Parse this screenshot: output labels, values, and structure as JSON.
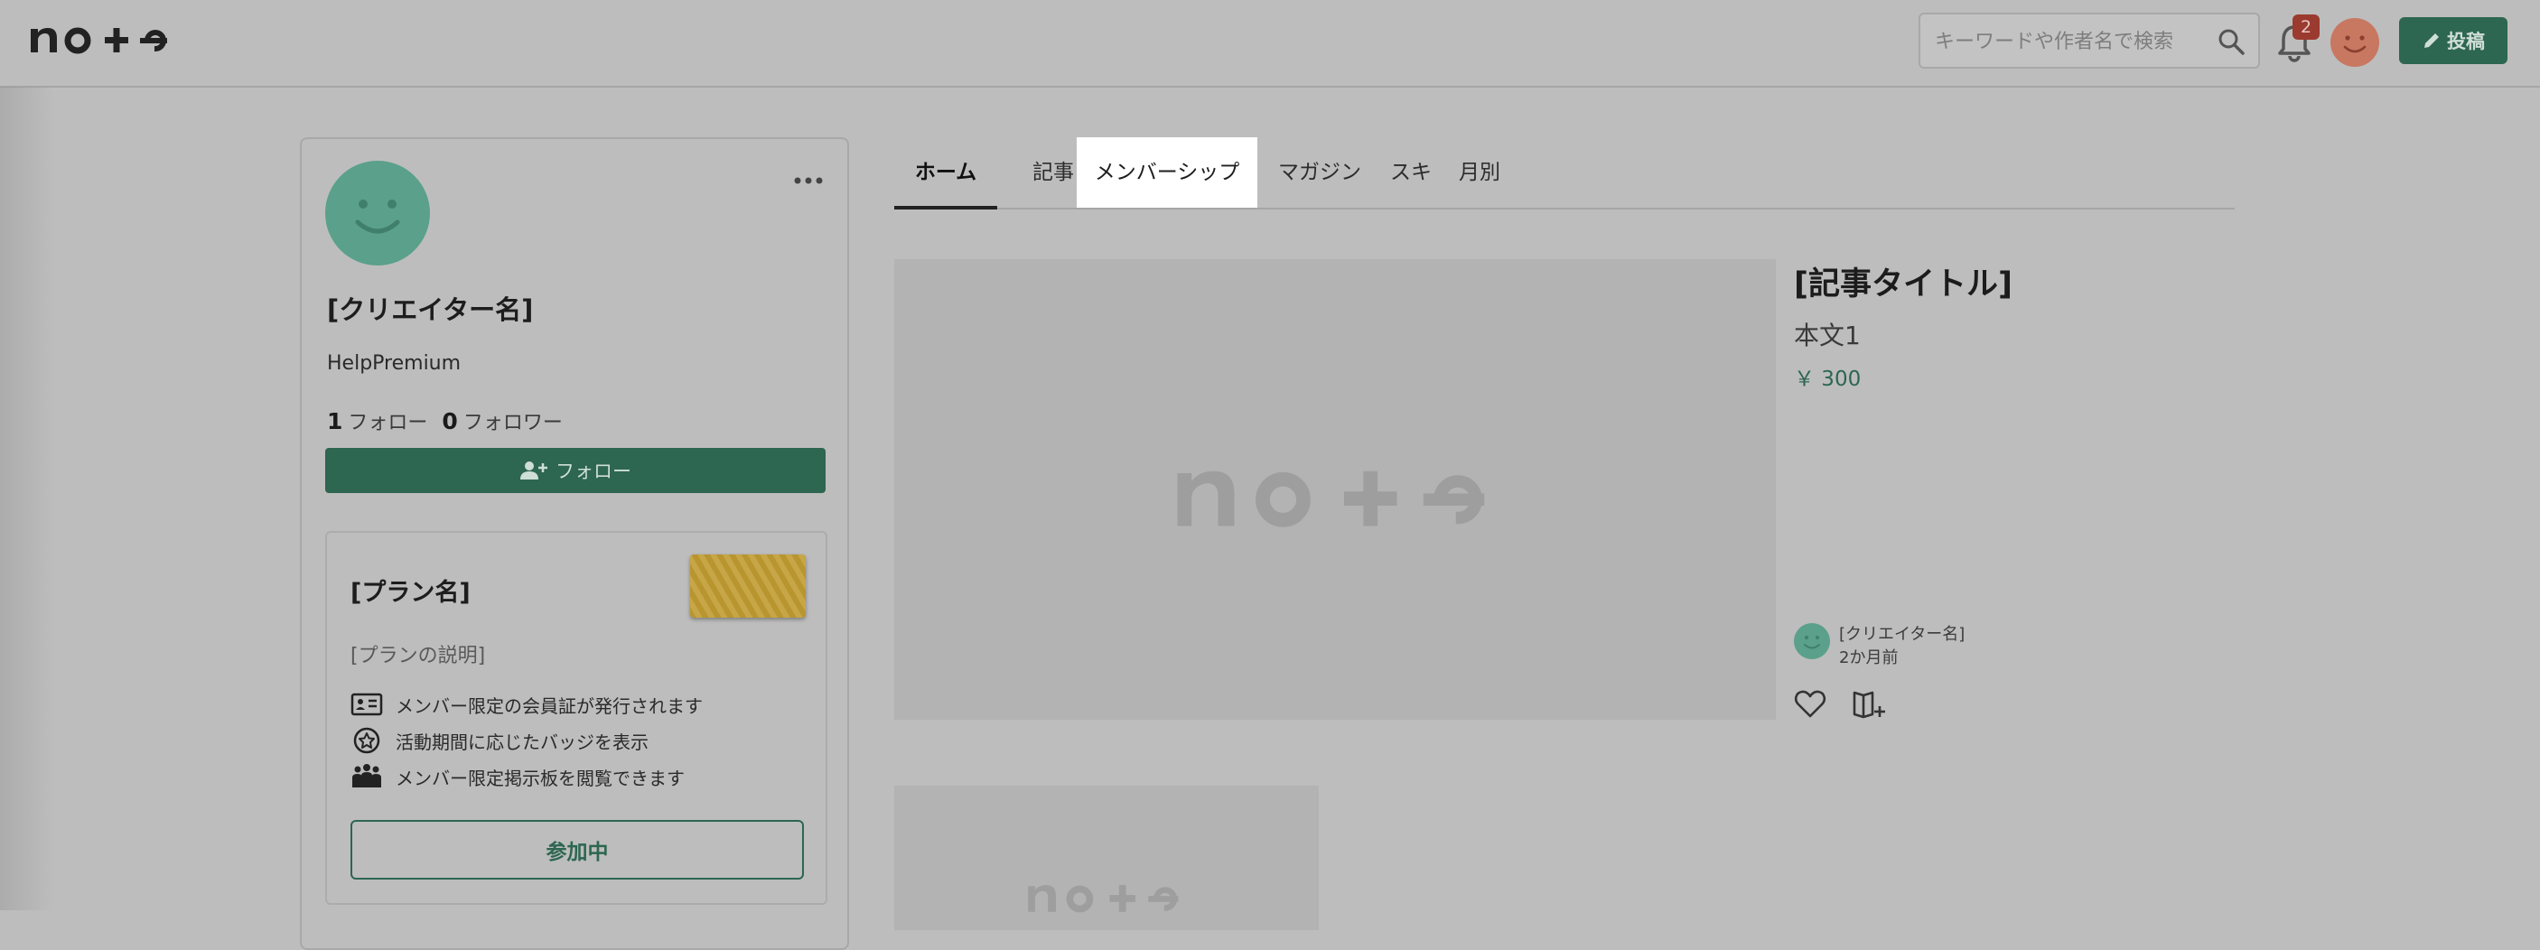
{
  "header": {
    "logo": "note",
    "search_placeholder": "キーワードや作者名で検索",
    "notification_count": "2",
    "post_label": "投稿"
  },
  "profile": {
    "creator_name": "[クリエイター名]",
    "plan": "HelpPremium",
    "follow_count": "1",
    "follow_label": "フォロー",
    "follower_count": "0",
    "follower_label": "フォロワー",
    "follow_button": "フォロー"
  },
  "membership": {
    "plan_name": "[プラン名]",
    "plan_desc": "[プランの説明]",
    "features": [
      {
        "icon": "member-card-icon",
        "label": "メンバー限定の会員証が発行されます"
      },
      {
        "icon": "badge-star-icon",
        "label": "活動期間に応じたバッジを表示"
      },
      {
        "icon": "group-icon",
        "label": "メンバー限定掲示板を閲覧できます"
      }
    ],
    "joined_button": "参加中"
  },
  "tabs": [
    {
      "label": "ホーム",
      "active": true
    },
    {
      "label": "記事"
    },
    {
      "label": "メンバーシップ",
      "highlight": true
    },
    {
      "label": "マガジン"
    },
    {
      "label": "スキ"
    },
    {
      "label": "月別"
    }
  ],
  "article": {
    "title": "[記事タイトル]",
    "body": "本文1",
    "price": "￥ 300",
    "author": "[クリエイター名]",
    "time": "2か月前",
    "placeholder_logo": "note"
  },
  "colors": {
    "brand_green": "#2d6651",
    "overlay_bg": "#bdbdbd",
    "avatar_green": "#5aa08a",
    "avatar_orange": "#c87761"
  }
}
